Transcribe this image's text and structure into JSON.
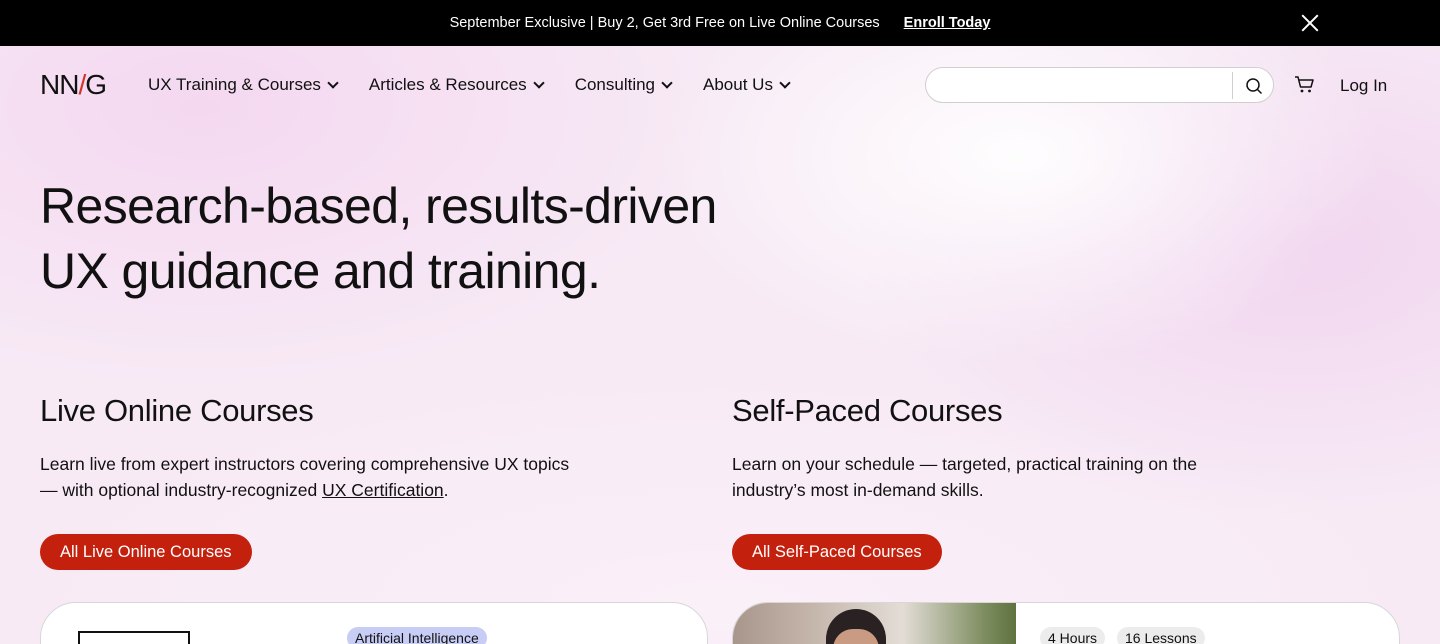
{
  "promo": {
    "text": "September Exclusive | Buy 2, Get 3rd Free on Live Online Courses",
    "link": "Enroll Today"
  },
  "header": {
    "logo_left": "NN",
    "logo_slash": "/",
    "logo_right": "G",
    "nav": [
      {
        "label": "UX Training & Courses"
      },
      {
        "label": "Articles & Resources"
      },
      {
        "label": "Consulting"
      },
      {
        "label": "About Us"
      }
    ],
    "search_value": "",
    "login": "Log In"
  },
  "hero": {
    "line1": "Research-based, results-driven",
    "line2": "UX guidance and training."
  },
  "live": {
    "title": "Live Online Courses",
    "desc_before": "Learn live from expert instructors covering comprehensive UX topics — with optional industry-recognized ",
    "desc_link": "UX Certification",
    "desc_after": ".",
    "button": "All Live Online Courses",
    "card_tag": "Artificial Intelligence"
  },
  "selfpaced": {
    "title": "Self-Paced Courses",
    "desc": "Learn on your schedule — targeted, practical training on the industry’s most in-demand skills.",
    "button": "All Self-Paced Courses",
    "card_hours": "4 Hours",
    "card_lessons": "16 Lessons"
  },
  "colors": {
    "accent_red": "#c3200e",
    "logo_slash": "#d6312a",
    "tag_ai": "#c8cdf5"
  },
  "icons": [
    "close-icon",
    "chevron-down-icon",
    "search-icon",
    "cart-icon"
  ]
}
